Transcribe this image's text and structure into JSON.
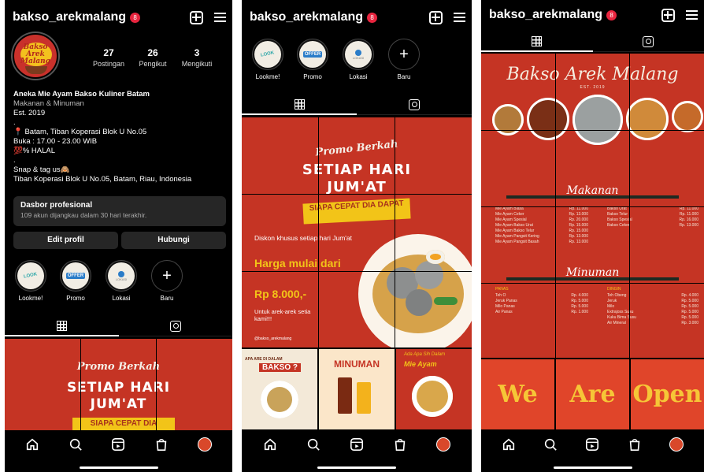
{
  "profile": {
    "username": "bakso_arekmalang",
    "badge_count": "8",
    "stats": [
      {
        "num": "27",
        "label": "Postingan"
      },
      {
        "num": "26",
        "label": "Pengikut"
      },
      {
        "num": "3",
        "label": "Mengikuti"
      }
    ],
    "avatar_lines": [
      "Bakso",
      "Arek",
      "Malang"
    ],
    "name": "Aneka Mie Ayam Bakso Kuliner Batam",
    "category": "Makanan & Minuman",
    "est": "Est. 2019",
    "dot1": ".",
    "location": "📍 Batam, Tiban Koperasi Blok U No.05",
    "hours": "Buka : 17.00 - 23.00 WIB",
    "halal": "💯% HALAL",
    "dot2": ".",
    "snap": "Snap & tag us🙈",
    "address": "Tiban Koperasi Blok U No.05, Batam, Riau, Indonesia",
    "dashboard_title": "Dasbor profesional",
    "dashboard_sub": "109 akun dijangkau dalam 30 hari terakhir.",
    "edit_button": "Edit profil",
    "contact_button": "Hubungi"
  },
  "highlights": [
    {
      "label": "Lookme!",
      "thumb": "LOOK"
    },
    {
      "label": "Promo",
      "thumb": "OFFER"
    },
    {
      "label": "Lokasi",
      "thumb": "LOKASI"
    },
    {
      "label": "Baru",
      "thumb": "+"
    }
  ],
  "promo_post": {
    "promo": "Promo Berkah",
    "line1": "SETIAP HARI",
    "line2": "JUM'AT",
    "yellow": "SIAPA CEPAT DIA DAPAT",
    "yellow_short": "SIAPA CEPAT DIA",
    "discount": "Diskon khusus setiap hari Jum'at",
    "price_label": "Harga mulai dari",
    "price": "Rp 8.000,-",
    "note": "Untuk arek-arek setia kami!!!",
    "handle": "@bakso_arekmalang"
  },
  "small_posts": [
    {
      "title": "APA ARE DI DALAM",
      "big": "BAKSO ?",
      "bg": "#f3e9d8"
    },
    {
      "title": "",
      "big": "MINUMAN",
      "bg": "#fbe6c9"
    },
    {
      "title": "Ada Apa Sih Dalam",
      "big": "Mie Ayam",
      "bg": "#c53424"
    }
  ],
  "menu_post": {
    "title": "Bakso Arek Malang",
    "est": "EST. 2019",
    "makanan": "Makanan",
    "minuman": "Minuman",
    "food_left": [
      [
        "Mie Ayam Biasa",
        "Rp. 11.000"
      ],
      [
        "Mie Ayam Ceker",
        "Rp. 13.000"
      ],
      [
        "Mie Ayam Spesial",
        "Rp. 20.000"
      ],
      [
        "Mie Ayam Bakso Urat",
        "Rp. 15.000"
      ],
      [
        "Mie Ayam Bakso Telur",
        "Rp. 15.000"
      ],
      [
        "Mie Ayam Pangsit Kering",
        "Rp. 13.000"
      ],
      [
        "Mie Ayam Pangsit Basah",
        "Rp. 13.000"
      ]
    ],
    "food_right": [
      [
        "Bakso Urat",
        "Rp. 11.000"
      ],
      [
        "Bakso Telur",
        "Rp. 11.000"
      ],
      [
        "Bakso Spesial",
        "Rp. 16.000"
      ],
      [
        "Bakso Ceker",
        "Rp. 13.000"
      ]
    ],
    "panas_label": "PANAS",
    "dingin_label": "DINGIN",
    "drinks_hot": [
      [
        "Teh O",
        "Rp. 4.000"
      ],
      [
        "Jeruk Panas",
        "Rp. 5.000"
      ],
      [
        "Milo Panas",
        "Rp. 5.000"
      ],
      [
        "Air Panas",
        "Rp. 1.000"
      ]
    ],
    "drinks_cold": [
      [
        "Teh Obeng",
        "Rp. 4.000"
      ],
      [
        "Jeruk",
        "Rp. 5.000"
      ],
      [
        "Milo",
        "Rp. 5.000"
      ],
      [
        "Extrajoss Susu",
        "Rp. 5.000"
      ],
      [
        "Kuku Bima Susu",
        "Rp. 5.000"
      ],
      [
        "Air Mineral",
        "Rp. 3.000"
      ]
    ],
    "words": [
      "We",
      "Are",
      "Open"
    ]
  },
  "colors": {
    "brand_red": "#c53424",
    "yellow": "#f2c418",
    "badge": "#e8253f"
  }
}
